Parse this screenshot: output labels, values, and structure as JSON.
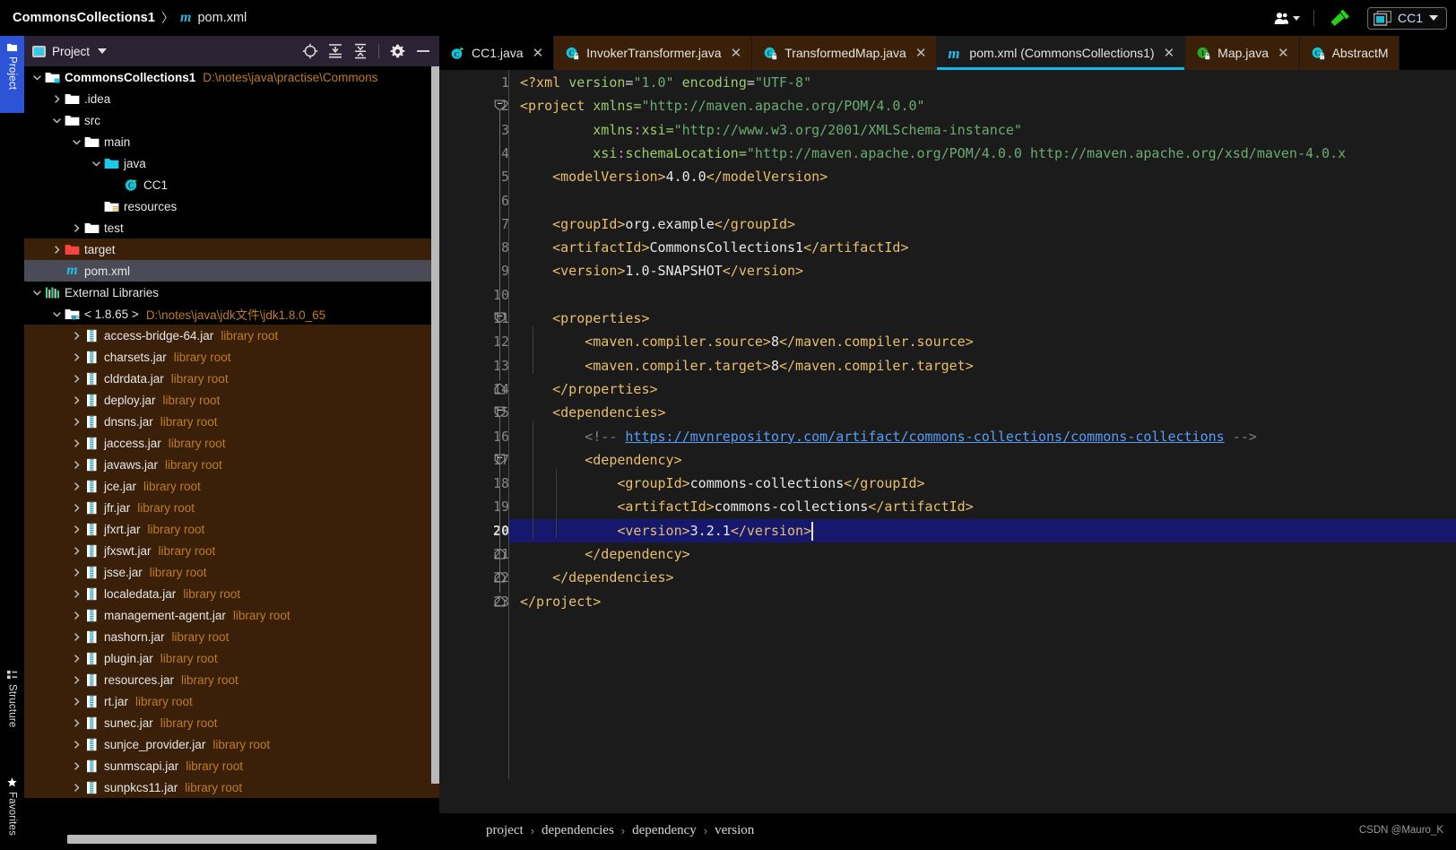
{
  "titlebar": {
    "project_name": "CommonsCollections1",
    "separator": "〉",
    "file_icon": "m",
    "file_name": "pom.xml",
    "users_icon": "people-icon",
    "build_icon": "hammer-icon",
    "run_config": "CC1"
  },
  "toolstrip": {
    "project_tab": "Project",
    "structure_tab": "Structure",
    "favorites_tab": "Favorites"
  },
  "panel": {
    "title": "Project",
    "tools": [
      "locate-icon",
      "expand-all-icon",
      "collapse-all-icon",
      "settings-icon",
      "minimize-icon"
    ]
  },
  "tree": [
    {
      "depth": 0,
      "arrow": "down",
      "icon": "module-folder-icon",
      "name": "CommonsCollections1",
      "bold": true,
      "sub": "D:\\notes\\java\\practise\\Commons",
      "state": "none"
    },
    {
      "depth": 1,
      "arrow": "right",
      "icon": "folder-icon",
      "name": ".idea",
      "bold": false,
      "sub": "",
      "state": "none"
    },
    {
      "depth": 1,
      "arrow": "down",
      "icon": "folder-icon",
      "name": "src",
      "bold": false,
      "sub": "",
      "state": "none"
    },
    {
      "depth": 2,
      "arrow": "down",
      "icon": "folder-icon",
      "name": "main",
      "bold": false,
      "sub": "",
      "state": "none"
    },
    {
      "depth": 3,
      "arrow": "down",
      "icon": "source-folder-icon",
      "name": "java",
      "bold": false,
      "sub": "",
      "state": "none"
    },
    {
      "depth": 4,
      "arrow": "none",
      "icon": "java-class-icon",
      "name": "CC1",
      "bold": false,
      "sub": "",
      "state": "none"
    },
    {
      "depth": 3,
      "arrow": "none",
      "icon": "resource-folder-icon",
      "name": "resources",
      "bold": false,
      "sub": "",
      "state": "none"
    },
    {
      "depth": 2,
      "arrow": "right",
      "icon": "folder-icon",
      "name": "test",
      "bold": false,
      "sub": "",
      "state": "none"
    },
    {
      "depth": 1,
      "arrow": "right",
      "icon": "excluded-folder-icon",
      "name": "target",
      "bold": false,
      "sub": "",
      "state": "lib"
    },
    {
      "depth": 1,
      "arrow": "none",
      "icon": "maven-icon",
      "name": "pom.xml",
      "bold": false,
      "sub": "",
      "state": "sel-pom"
    },
    {
      "depth": 0,
      "arrow": "down",
      "icon": "libraries-icon",
      "name": "External Libraries",
      "bold": false,
      "sub": "",
      "state": "none"
    },
    {
      "depth": 1,
      "arrow": "down",
      "icon": "jdk-icon",
      "name": "< 1.8.65 >",
      "bold": false,
      "sub": "D:\\notes\\java\\jdk文件\\jdk1.8.0_65",
      "state": "none"
    },
    {
      "depth": 2,
      "arrow": "right",
      "icon": "jar-icon",
      "name": "access-bridge-64.jar",
      "bold": false,
      "sub": "library root",
      "state": "lib"
    },
    {
      "depth": 2,
      "arrow": "right",
      "icon": "jar-icon",
      "name": "charsets.jar",
      "bold": false,
      "sub": "library root",
      "state": "lib"
    },
    {
      "depth": 2,
      "arrow": "right",
      "icon": "jar-icon",
      "name": "cldrdata.jar",
      "bold": false,
      "sub": "library root",
      "state": "lib"
    },
    {
      "depth": 2,
      "arrow": "right",
      "icon": "jar-icon",
      "name": "deploy.jar",
      "bold": false,
      "sub": "library root",
      "state": "lib"
    },
    {
      "depth": 2,
      "arrow": "right",
      "icon": "jar-icon",
      "name": "dnsns.jar",
      "bold": false,
      "sub": "library root",
      "state": "lib"
    },
    {
      "depth": 2,
      "arrow": "right",
      "icon": "jar-icon",
      "name": "jaccess.jar",
      "bold": false,
      "sub": "library root",
      "state": "lib"
    },
    {
      "depth": 2,
      "arrow": "right",
      "icon": "jar-icon",
      "name": "javaws.jar",
      "bold": false,
      "sub": "library root",
      "state": "lib"
    },
    {
      "depth": 2,
      "arrow": "right",
      "icon": "jar-icon",
      "name": "jce.jar",
      "bold": false,
      "sub": "library root",
      "state": "lib"
    },
    {
      "depth": 2,
      "arrow": "right",
      "icon": "jar-icon",
      "name": "jfr.jar",
      "bold": false,
      "sub": "library root",
      "state": "lib"
    },
    {
      "depth": 2,
      "arrow": "right",
      "icon": "jar-icon",
      "name": "jfxrt.jar",
      "bold": false,
      "sub": "library root",
      "state": "lib"
    },
    {
      "depth": 2,
      "arrow": "right",
      "icon": "jar-icon",
      "name": "jfxswt.jar",
      "bold": false,
      "sub": "library root",
      "state": "lib"
    },
    {
      "depth": 2,
      "arrow": "right",
      "icon": "jar-icon",
      "name": "jsse.jar",
      "bold": false,
      "sub": "library root",
      "state": "lib"
    },
    {
      "depth": 2,
      "arrow": "right",
      "icon": "jar-icon",
      "name": "localedata.jar",
      "bold": false,
      "sub": "library root",
      "state": "lib"
    },
    {
      "depth": 2,
      "arrow": "right",
      "icon": "jar-icon",
      "name": "management-agent.jar",
      "bold": false,
      "sub": "library root",
      "state": "lib"
    },
    {
      "depth": 2,
      "arrow": "right",
      "icon": "jar-icon",
      "name": "nashorn.jar",
      "bold": false,
      "sub": "library root",
      "state": "lib"
    },
    {
      "depth": 2,
      "arrow": "right",
      "icon": "jar-icon",
      "name": "plugin.jar",
      "bold": false,
      "sub": "library root",
      "state": "lib"
    },
    {
      "depth": 2,
      "arrow": "right",
      "icon": "jar-icon",
      "name": "resources.jar",
      "bold": false,
      "sub": "library root",
      "state": "lib"
    },
    {
      "depth": 2,
      "arrow": "right",
      "icon": "jar-icon",
      "name": "rt.jar",
      "bold": false,
      "sub": "library root",
      "state": "lib"
    },
    {
      "depth": 2,
      "arrow": "right",
      "icon": "jar-icon",
      "name": "sunec.jar",
      "bold": false,
      "sub": "library root",
      "state": "lib"
    },
    {
      "depth": 2,
      "arrow": "right",
      "icon": "jar-icon",
      "name": "sunjce_provider.jar",
      "bold": false,
      "sub": "library root",
      "state": "lib"
    },
    {
      "depth": 2,
      "arrow": "right",
      "icon": "jar-icon",
      "name": "sunmscapi.jar",
      "bold": false,
      "sub": "library root",
      "state": "lib"
    },
    {
      "depth": 2,
      "arrow": "right",
      "icon": "jar-icon",
      "name": "sunpkcs11.jar",
      "bold": false,
      "sub": "library root",
      "state": "lib"
    }
  ],
  "editor_tabs": [
    {
      "label": "CC1.java",
      "icon": "java-class-run-icon",
      "active": false,
      "style": "dark"
    },
    {
      "label": "InvokerTransformer.java",
      "icon": "java-class-lock-icon",
      "active": false,
      "style": "lib"
    },
    {
      "label": "TransformedMap.java",
      "icon": "java-class-lock-icon",
      "active": false,
      "style": "lib"
    },
    {
      "label": "pom.xml (CommonsCollections1)",
      "icon": "maven-icon",
      "active": true,
      "style": "active"
    },
    {
      "label": "Map.java",
      "icon": "java-interface-lock-icon",
      "active": false,
      "style": "lib"
    },
    {
      "label": "AbstractM",
      "icon": "java-class-lock-icon",
      "active": false,
      "style": "lib"
    }
  ],
  "code": {
    "current_line": 20,
    "lines": [
      "1",
      "2",
      "3",
      "4",
      "5",
      "6",
      "7",
      "8",
      "9",
      "10",
      "11",
      "12",
      "13",
      "14",
      "15",
      "16",
      "17",
      "18",
      "19",
      "20",
      "21",
      "22",
      "23"
    ],
    "text": [
      "<?xml version=\"1.0\" encoding=\"UTF-8\"?>",
      "<project xmlns=\"http://maven.apache.org/POM/4.0.0\"",
      "         xmlns:xsi=\"http://www.w3.org/2001/XMLSchema-instance\"",
      "         xsi:schemaLocation=\"http://maven.apache.org/POM/4.0.0 http://maven.apache.org/xsd/maven-4.0.x",
      "    <modelVersion>4.0.0</modelVersion>",
      "",
      "    <groupId>org.example</groupId>",
      "    <artifactId>CommonsCollections1</artifactId>",
      "    <version>1.0-SNAPSHOT</version>",
      "",
      "    <properties>",
      "        <maven.compiler.source>8</maven.compiler.source>",
      "        <maven.compiler.target>8</maven.compiler.target>",
      "    </properties>",
      "    <dependencies>",
      "        <!-- https://mvnrepository.com/artifact/commons-collections/commons-collections -->",
      "        <dependency>",
      "            <groupId>commons-collections</groupId>",
      "            <artifactId>commons-collections</artifactId>",
      "            <version>3.2.1</version>",
      "        </dependency>",
      "    </dependencies>",
      "</project>"
    ],
    "comment_url": "https://mvnrepository.com/artifact/commons-collections/commons-collections"
  },
  "breadcrumb": {
    "items": [
      "project",
      "dependencies",
      "dependency",
      "version"
    ],
    "separator": "›",
    "watermark": "CSDN @Mauro_K"
  },
  "colors": {
    "accent": "#12b8e8",
    "tag": "#e8bf6a",
    "attribute": "#9dca6b",
    "string": "#6aab73",
    "namespace": "#cb7fd0",
    "comment": "#808080",
    "link": "#589df6",
    "library_row": "#3a2008",
    "selected_row": "#4b4b57",
    "current_line": "#16186e"
  }
}
